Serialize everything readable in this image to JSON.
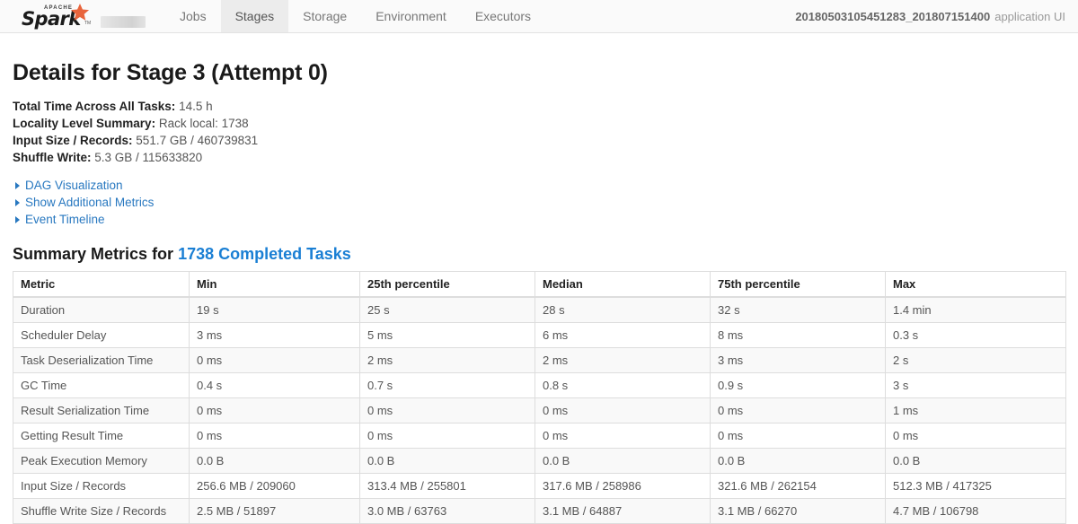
{
  "navbar": {
    "logo": {
      "apache": "APACHE",
      "spark": "Spark",
      "tm": "TM",
      "star_icon": "star-icon"
    },
    "items": [
      {
        "label": "Jobs",
        "active": false
      },
      {
        "label": "Stages",
        "active": true
      },
      {
        "label": "Storage",
        "active": false
      },
      {
        "label": "Environment",
        "active": false
      },
      {
        "label": "Executors",
        "active": false
      }
    ],
    "app_id": "20180503105451283_201807151400",
    "app_suffix": "application UI"
  },
  "page": {
    "title": "Details for Stage 3 (Attempt 0)",
    "summary": [
      {
        "label": "Total Time Across All Tasks:",
        "value": "14.5 h"
      },
      {
        "label": "Locality Level Summary:",
        "value": "Rack local: 1738"
      },
      {
        "label": "Input Size / Records:",
        "value": "551.7 GB / 460739831"
      },
      {
        "label": "Shuffle Write:",
        "value": "5.3 GB / 115633820"
      }
    ],
    "toggles": [
      {
        "label": "DAG Visualization"
      },
      {
        "label": "Show Additional Metrics"
      },
      {
        "label": "Event Timeline"
      }
    ],
    "summary_metrics": {
      "prefix": "Summary Metrics for ",
      "link": "1738 Completed Tasks"
    }
  },
  "table": {
    "columns": [
      "Metric",
      "Min",
      "25th percentile",
      "Median",
      "75th percentile",
      "Max"
    ],
    "rows": [
      {
        "metric": "Duration",
        "min": "19 s",
        "p25": "25 s",
        "median": "28 s",
        "p75": "32 s",
        "max": "1.4 min"
      },
      {
        "metric": "Scheduler Delay",
        "min": "3 ms",
        "p25": "5 ms",
        "median": "6 ms",
        "p75": "8 ms",
        "max": "0.3 s"
      },
      {
        "metric": "Task Deserialization Time",
        "min": "0 ms",
        "p25": "2 ms",
        "median": "2 ms",
        "p75": "3 ms",
        "max": "2 s"
      },
      {
        "metric": "GC Time",
        "min": "0.4 s",
        "p25": "0.7 s",
        "median": "0.8 s",
        "p75": "0.9 s",
        "max": "3 s"
      },
      {
        "metric": "Result Serialization Time",
        "min": "0 ms",
        "p25": "0 ms",
        "median": "0 ms",
        "p75": "0 ms",
        "max": "1 ms"
      },
      {
        "metric": "Getting Result Time",
        "min": "0 ms",
        "p25": "0 ms",
        "median": "0 ms",
        "p75": "0 ms",
        "max": "0 ms"
      },
      {
        "metric": "Peak Execution Memory",
        "min": "0.0 B",
        "p25": "0.0 B",
        "median": "0.0 B",
        "p75": "0.0 B",
        "max": "0.0 B"
      },
      {
        "metric": "Input Size / Records",
        "min": "256.6 MB / 209060",
        "p25": "313.4 MB / 255801",
        "median": "317.6 MB / 258986",
        "p75": "321.6 MB / 262154",
        "max": "512.3 MB / 417325"
      },
      {
        "metric": "Shuffle Write Size / Records",
        "min": "2.5 MB / 51897",
        "p25": "3.0 MB / 63763",
        "median": "3.1 MB / 64887",
        "p75": "3.1 MB / 66270",
        "max": "4.7 MB / 106798"
      }
    ]
  },
  "colors": {
    "link": "#1a7fd4",
    "toggle_link": "#2878c0",
    "logo_star": "#e8643c",
    "navbar_bg": "#fafafa",
    "active_tab_bg": "#ececec"
  }
}
